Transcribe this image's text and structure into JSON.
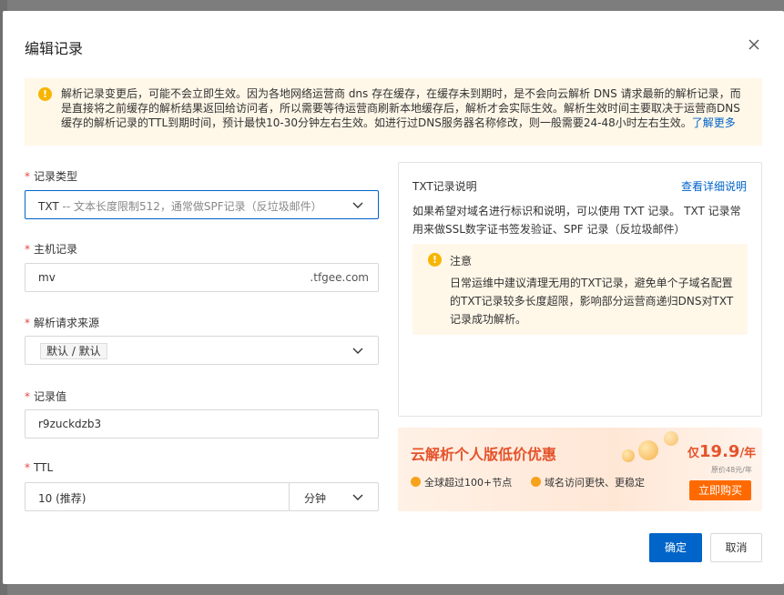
{
  "dialog": {
    "title": "编辑记录"
  },
  "alert": {
    "text": "解析记录变更后，可能不会立即生效。因为各地网络运营商 dns 存在缓存，在缓存未到期时，是不会向云解析 DNS 请求最新的解析记录，而是直接将之前缓存的解析结果返回给访问者，所以需要等待运营商刷新本地缓存后，解析才会实际生效。解析生效时间主要取决于运营商DNS缓存的解析记录的TTL到期时间，预计最快10-30分钟左右生效。如进行过DNS服务器名称修改，则一般需要24-48小时左右生效。",
    "link": "了解更多"
  },
  "form": {
    "record_type": {
      "label": "记录类型",
      "value": "TXT",
      "hint": " -- 文本长度限制512，通常做SPF记录（反垃圾邮件）"
    },
    "host": {
      "label": "主机记录",
      "value": "mv",
      "suffix": ".tfgee.com"
    },
    "source": {
      "label": "解析请求来源",
      "value": "默认 / 默认"
    },
    "record_value": {
      "label": "记录值",
      "value": "r9zuckdzb3"
    },
    "ttl": {
      "label": "TTL",
      "value": "10 (推荐)",
      "unit": "分钟"
    }
  },
  "info": {
    "title": "TXT记录说明",
    "link": "查看详细说明",
    "desc": "如果希望对域名进行标识和说明，可以使用 TXT 记录。 TXT 记录常用来做SSL数字证书签发验证、SPF 记录（反垃圾邮件）",
    "note_title": "注意",
    "note_body": "日常运维中建议清理无用的TXT记录，避免单个子域名配置的TXT记录较多长度超限，影响部分运营商递归DNS对TXT记录成功解析。"
  },
  "promo": {
    "title": "云解析个人版低价优惠",
    "feature1": "全球超过100+节点",
    "feature2": "域名访问更快、更稳定",
    "price_prefix": "仅",
    "price": "19.9",
    "price_suffix": "/年",
    "original": "原价48元/年",
    "buy": "立即购买"
  },
  "footer": {
    "confirm": "确定",
    "cancel": "取消"
  },
  "colors": {
    "primary": "#0064c8",
    "warning": "#f7b500",
    "required": "#e54545",
    "promo": "#e5532b",
    "buy": "#ff6a00"
  }
}
